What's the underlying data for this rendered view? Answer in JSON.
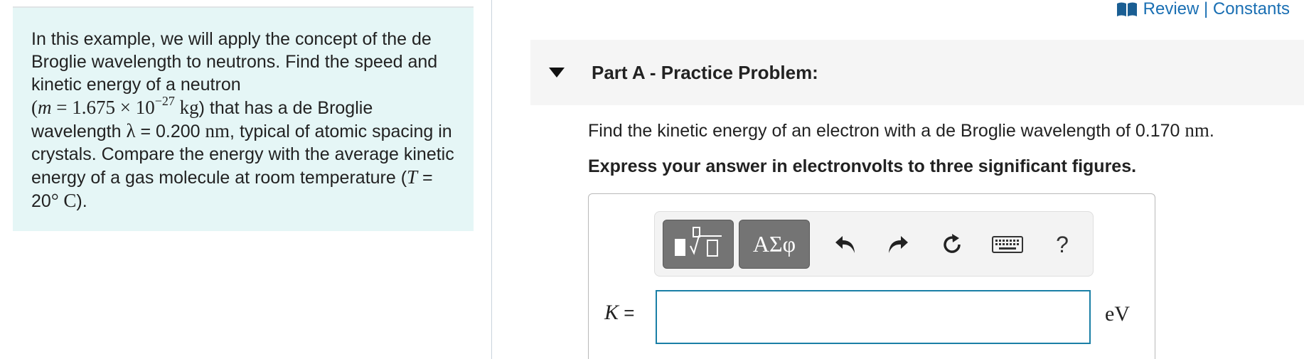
{
  "review": {
    "label": "Review | Constants",
    "icon": "book-icon"
  },
  "example": {
    "text1": "In this example, we will apply the concept of the de Broglie wavelength to neutrons. Find the speed and kinetic energy of a neutron",
    "mass_open": "(",
    "mass_symbol": "m",
    "mass_eq": " = 1.675 × 10",
    "mass_exp": "−27",
    "mass_unit": " kg",
    "text2": ") that has a de Broglie wavelength ",
    "lambda": "λ",
    "lambda_val": " = 0.200 ",
    "lambda_unit": "nm",
    "text3": ", typical of atomic spacing in crystals. Compare the energy with the average kinetic energy of a gas molecule at room temperature (",
    "temp_symbol": "T",
    "temp_val": " = 20",
    "temp_unit": "° C",
    "text4": ")."
  },
  "part": {
    "title": "Part A - Practice Problem:",
    "caret": "caret-down-icon"
  },
  "question": {
    "text": "Find the kinetic energy of an electron with a de Broglie wavelength of 0.170 ",
    "unit": "nm",
    "end": "."
  },
  "instruction": "Express your answer in electronvolts to three significant figures.",
  "toolbar": {
    "symbols_label": "ΑΣφ",
    "help_label": "?",
    "icons": [
      "templates-icon",
      "undo-icon",
      "redo-icon",
      "reset-icon",
      "keyboard-icon",
      "help-icon"
    ]
  },
  "answer": {
    "variable": "K",
    "equals": " =",
    "value": "",
    "unit": "eV"
  },
  "colors": {
    "example_bg": "#e5f6f6",
    "link": "#1a6fb3",
    "input_border": "#1a7fa6",
    "toolbar_button": "#747474"
  }
}
